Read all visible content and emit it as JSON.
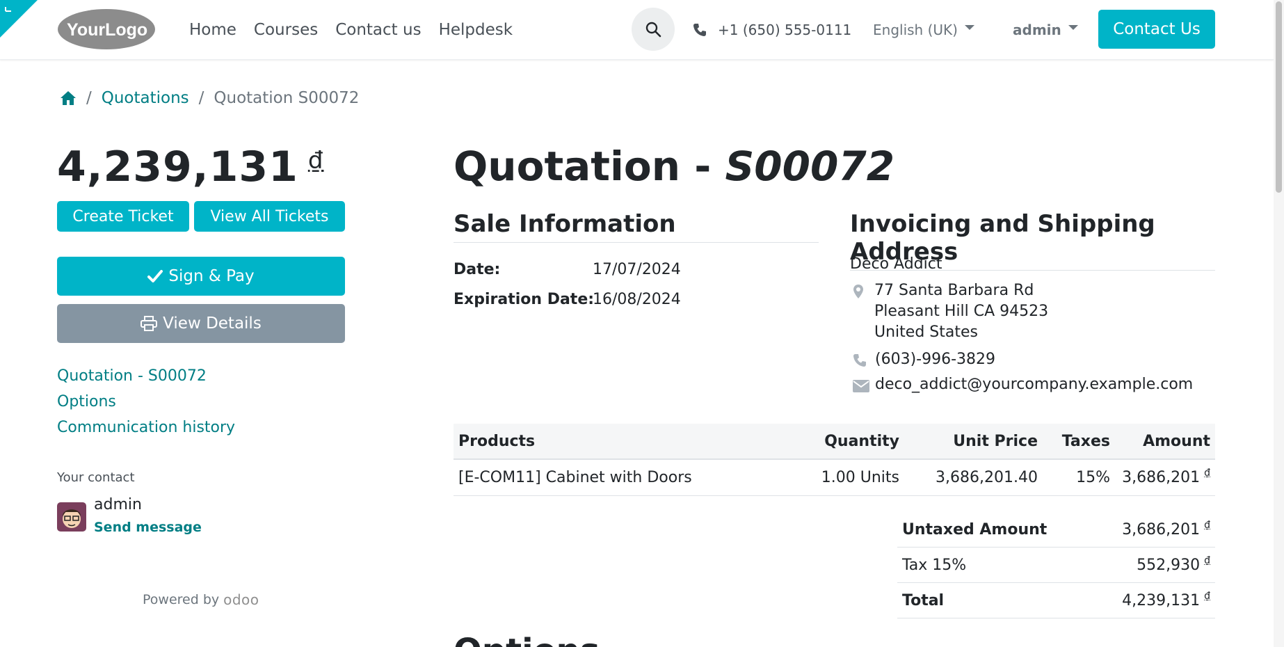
{
  "colors": {
    "accent": "#00b4c8",
    "link": "#017e84",
    "secondary_button": "#8595a2"
  },
  "header": {
    "logo_text": "YourLogo",
    "nav": [
      "Home",
      "Courses",
      "Contact us",
      "Helpdesk"
    ],
    "phone": "+1 (650) 555-0111",
    "language": "English (UK)",
    "user": "admin",
    "contact_button": "Contact Us"
  },
  "breadcrumb": {
    "link": "Quotations",
    "current": "Quotation S00072"
  },
  "sidebar": {
    "amount": "4,239,131",
    "currency": "₫",
    "create_ticket": "Create Ticket",
    "view_all_tickets": "View All Tickets",
    "sign_pay": "Sign & Pay",
    "view_details": "View Details",
    "links": [
      "Quotation - S00072",
      "Options",
      "Communication history"
    ],
    "contact_label": "Your contact",
    "contact_name": "admin",
    "send_message": "Send message",
    "powered_by": "Powered by",
    "powered_brand": "odoo"
  },
  "main": {
    "title_prefix": "Quotation - ",
    "title_ref": "S00072",
    "sale_info_title": "Sale Information",
    "date_label": "Date:",
    "date_value": "17/07/2024",
    "expiration_label": "Expiration Date:",
    "expiration_value": "16/08/2024",
    "address_title": "Invoicing and Shipping Address",
    "customer": "Deco Addict",
    "address_lines": [
      "77 Santa Barbara Rd",
      "Pleasant Hill CA 94523",
      "United States"
    ],
    "phone": "(603)-996-3829",
    "email": "deco_addict@yourcompany.example.com",
    "table": {
      "headers": [
        "Products",
        "Quantity",
        "Unit Price",
        "Taxes",
        "Amount"
      ],
      "rows": [
        {
          "product": "[E-COM11] Cabinet with Doors",
          "quantity": "1.00 Units",
          "unit_price": "3,686,201.40",
          "taxes": "15%",
          "amount": "3,686,201",
          "currency": "₫"
        }
      ]
    },
    "totals": [
      {
        "label": "Untaxed Amount",
        "value": "3,686,201",
        "currency": "₫"
      },
      {
        "label": "Tax 15%",
        "value": "552,930",
        "currency": "₫"
      },
      {
        "label": "Total",
        "value": "4,239,131",
        "currency": "₫"
      }
    ],
    "next_section_peek": "Options"
  }
}
